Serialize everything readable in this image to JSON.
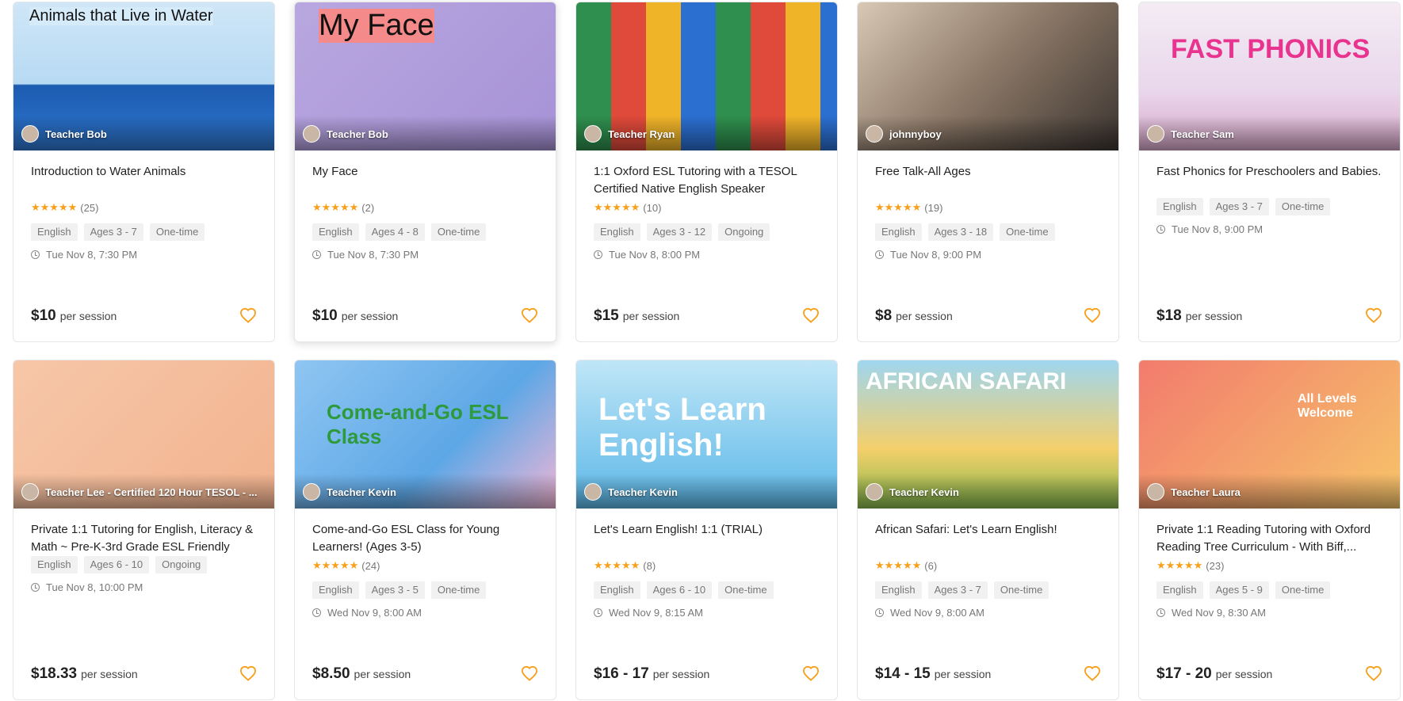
{
  "colors": {
    "star": "#f7a01b",
    "heart": "#f7a01b"
  },
  "price_suffix": "per session",
  "cards": [
    {
      "teacher": "Teacher Bob",
      "thumb_text": "Animals that Live in Water",
      "title": "Introduction to Water Animals",
      "rating_count": "(25)",
      "tags": [
        "English",
        "Ages 3 - 7",
        "One-time"
      ],
      "time": "Tue Nov 8, 7:30 PM",
      "price": "$10"
    },
    {
      "teacher": "Teacher Bob",
      "thumb_text": "My Face",
      "title": "My Face",
      "rating_count": "(2)",
      "tags": [
        "English",
        "Ages 4 - 8",
        "One-time"
      ],
      "time": "Tue Nov 8, 7:30 PM",
      "price": "$10"
    },
    {
      "teacher": "Teacher Ryan",
      "thumb_text": "",
      "title": "1:1 Oxford ESL Tutoring with a TESOL Certified Native English Speaker",
      "rating_count": "(10)",
      "tags": [
        "English",
        "Ages 3 - 12",
        "Ongoing"
      ],
      "time": "Tue Nov 8, 8:00 PM",
      "price": "$15"
    },
    {
      "teacher": "johnnyboy",
      "thumb_text": "",
      "title": "Free Talk-All Ages",
      "rating_count": "(19)",
      "tags": [
        "English",
        "Ages 3 - 18",
        "One-time"
      ],
      "time": "Tue Nov 8, 9:00 PM",
      "price": "$8"
    },
    {
      "teacher": "Teacher Sam",
      "thumb_text": "FAST PHONICS",
      "title": "Fast Phonics for Preschoolers and Babies.",
      "rating_count": "",
      "tags": [
        "English",
        "Ages 3 - 7",
        "One-time"
      ],
      "time": "Tue Nov 8, 9:00 PM",
      "price": "$18"
    },
    {
      "teacher": "Teacher Lee - Certified 120 Hour TESOL - ...",
      "thumb_text": "",
      "title": "Private 1:1 Tutoring for English, Literacy & Math ~ Pre-K-3rd Grade ESL Friendly",
      "rating_count": "",
      "tags": [
        "English",
        "Ages 6 - 10",
        "Ongoing"
      ],
      "time": "Tue Nov 8, 10:00 PM",
      "price": "$18.33"
    },
    {
      "teacher": "Teacher Kevin",
      "thumb_text": "Come-and-Go ESL Class",
      "title": "Come-and-Go ESL Class for Young Learners! (Ages 3-5)",
      "rating_count": "(24)",
      "tags": [
        "English",
        "Ages 3 - 5",
        "One-time"
      ],
      "time": "Wed Nov 9, 8:00 AM",
      "price": "$8.50"
    },
    {
      "teacher": "Teacher Kevin",
      "thumb_text": "Let's Learn English!",
      "title": "Let's Learn English! 1:1 (TRIAL)",
      "rating_count": "(8)",
      "tags": [
        "English",
        "Ages 6 - 10",
        "One-time"
      ],
      "time": "Wed Nov 9, 8:15 AM",
      "price": "$16 - 17"
    },
    {
      "teacher": "Teacher Kevin",
      "thumb_text": "AFRICAN SAFARI",
      "title": "African Safari: Let's Learn English!",
      "rating_count": "(6)",
      "tags": [
        "English",
        "Ages 3 - 7",
        "One-time"
      ],
      "time": "Wed Nov 9, 8:00 AM",
      "price": "$14 - 15"
    },
    {
      "teacher": "Teacher Laura",
      "thumb_text": "All Levels Welcome",
      "title": "Private 1:1 Reading Tutoring with Oxford Reading Tree Curriculum - With Biff,...",
      "rating_count": "(23)",
      "tags": [
        "English",
        "Ages 5 - 9",
        "One-time"
      ],
      "time": "Wed Nov 9, 8:30 AM",
      "price": "$17 - 20"
    }
  ]
}
